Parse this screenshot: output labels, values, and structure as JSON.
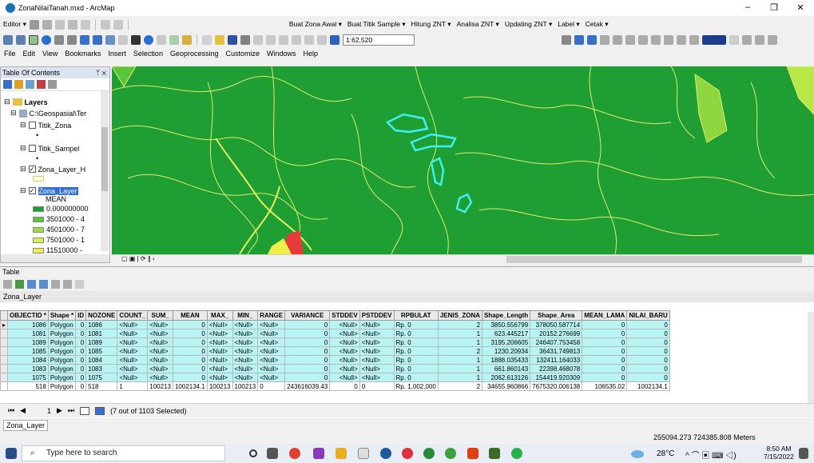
{
  "window": {
    "title": "ZonaNilaiTanah.mxd - ArcMap",
    "minimize": "–",
    "maximize": "❐",
    "close": "✕"
  },
  "toolbar1": {
    "editor": "Editor ▾",
    "menus": [
      "Buat Zona Awal ▾",
      "Buat Titik Sample ▾",
      "Hitung ZNT ▾",
      "Analisa ZNT ▾",
      "Updating ZNT ▾",
      "Label ▾",
      "Cetak ▾"
    ]
  },
  "toolbar2": {
    "scale": "1:62,520"
  },
  "menubar": [
    "File",
    "Edit",
    "View",
    "Bookmarks",
    "Insert",
    "Selection",
    "Geoprocessing",
    "Customize",
    "Windows",
    "Help"
  ],
  "toc": {
    "title": "Table Of Contents",
    "pin": "ᛘ ✕",
    "layers_label": "Layers",
    "path": "C:\\Geospasial\\Ter",
    "items": [
      "Titik_Zona",
      "Titik_Sampel",
      "Zona_Layer_H",
      "Zona_Layer"
    ],
    "mean_label": "MEAN",
    "legend": [
      {
        "label": "0.000000000",
        "color": "#1f9e33"
      },
      {
        "label": "3501000 - 4",
        "color": "#5cc43a"
      },
      {
        "label": "4501000 - 7",
        "color": "#9ede3e"
      },
      {
        "label": "7501000 - 1",
        "color": "#d8f04c"
      },
      {
        "label": "11510000 -",
        "color": "#f0f04a"
      }
    ]
  },
  "table": {
    "section_title": "Table",
    "layer_name": "Zona_Layer",
    "headers": [
      "OBJECTID *",
      "Shape *",
      "ID",
      "NOZONE",
      "COUNT_",
      "SUM_",
      "MEAN",
      "MAX_",
      "MIN_",
      "RANGE",
      "VARIANCE",
      "STDDEV",
      "PSTDDEV",
      "RPBULAT",
      "JENIS_ZONA",
      "Shape_Length",
      "Shape_Area",
      "MEAN_LAMA",
      "NILAI_BARU"
    ],
    "rows": [
      [
        "1086",
        "Polygon",
        "0",
        "1086",
        "<Null>",
        "<Null>",
        "0",
        "<Null>",
        "<Null>",
        "<Null>",
        "0",
        "<Null>",
        "<Null>",
        "Rp. 0",
        "2",
        "3850.556799",
        "378050.587714",
        "0",
        "0"
      ],
      [
        "1081",
        "Polygon",
        "0",
        "1081",
        "<Null>",
        "<Null>",
        "0",
        "<Null>",
        "<Null>",
        "<Null>",
        "0",
        "<Null>",
        "<Null>",
        "Rp. 0",
        "1",
        "623.445217",
        "20152.276699",
        "0",
        "0"
      ],
      [
        "1089",
        "Polygon",
        "0",
        "1089",
        "<Null>",
        "<Null>",
        "0",
        "<Null>",
        "<Null>",
        "<Null>",
        "0",
        "<Null>",
        "<Null>",
        "Rp. 0",
        "1",
        "3195.206605",
        "246407.753458",
        "0",
        "0"
      ],
      [
        "1085",
        "Polygon",
        "0",
        "1085",
        "<Null>",
        "<Null>",
        "0",
        "<Null>",
        "<Null>",
        "<Null>",
        "0",
        "<Null>",
        "<Null>",
        "Rp. 0",
        "2",
        "1230.20934",
        "36431.749813",
        "0",
        "0"
      ],
      [
        "1084",
        "Polygon",
        "0",
        "1084",
        "<Null>",
        "<Null>",
        "0",
        "<Null>",
        "<Null>",
        "<Null>",
        "0",
        "<Null>",
        "<Null>",
        "Rp. 0",
        "1",
        "1888.035433",
        "132411.164033",
        "0",
        "0"
      ],
      [
        "1083",
        "Polygon",
        "0",
        "1083",
        "<Null>",
        "<Null>",
        "0",
        "<Null>",
        "<Null>",
        "<Null>",
        "0",
        "<Null>",
        "<Null>",
        "Rp. 0",
        "1",
        "661.860143",
        "22398.468078",
        "0",
        "0"
      ],
      [
        "1075",
        "Polygon",
        "0",
        "1075",
        "<Null>",
        "<Null>",
        "0",
        "<Null>",
        "<Null>",
        "<Null>",
        "0",
        "<Null>",
        "<Null>",
        "Rp. 0",
        "1",
        "2062.613126",
        "154419.920309",
        "0",
        "0"
      ],
      [
        "518",
        "Polygon",
        "0",
        "518",
        "1",
        "100213",
        "1002134.1",
        "100213",
        "100213",
        "0",
        "243616039.43",
        "0",
        "0",
        "Rp. 1,002,000",
        "2",
        "34655.960866",
        "7675320.006138",
        "106535.02",
        "1002134.1"
      ]
    ]
  },
  "nav": {
    "first": "⏮",
    "prev": "◀",
    "page": "1",
    "next": "▶",
    "last": "⏭",
    "selection": "(7 out of 1103 Selected)"
  },
  "tab": "Zona_Layer",
  "status": {
    "coords": "255094.273 724385.808 Meters"
  },
  "taskbar": {
    "search": "Type here to search",
    "temp": "28°C",
    "time": "8:50 AM",
    "date": "7/15/2022"
  }
}
